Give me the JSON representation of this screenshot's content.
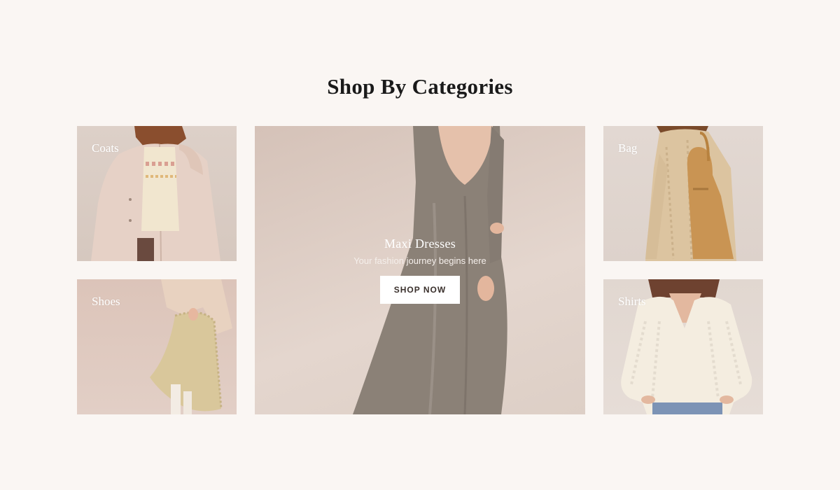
{
  "section": {
    "title": "Shop By Categories"
  },
  "categories": {
    "coats": {
      "label": "Coats"
    },
    "shoes": {
      "label": "Shoes"
    },
    "bag": {
      "label": "Bag"
    },
    "shirts": {
      "label": "Shirts"
    }
  },
  "hero": {
    "title": "Maxi Dresses",
    "subtitle": "Your fashion journey begins here",
    "button_label": "SHOP NOW"
  },
  "colors": {
    "page_background": "#faf6f3",
    "title_text": "#1a1a1a",
    "overlay_text": "#ffffff",
    "button_background": "#ffffff",
    "button_text": "#3a302c"
  }
}
